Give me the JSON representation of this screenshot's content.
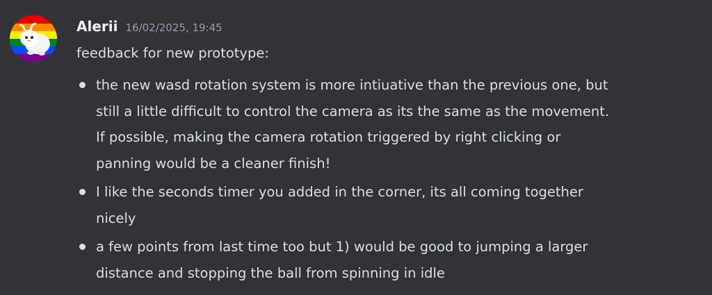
{
  "message": {
    "username": "Alerii",
    "timestamp": "16/02/2025, 19:45",
    "avatar_icon": "white-creature-on-rainbow-flag-avatar",
    "intro": "feedback for new prototype:",
    "bullets": [
      {
        "lines": [
          "the new wasd rotation system is more intiuative than the previous one, but",
          "still a little difficult to control the camera as its the same as the movement.",
          "If possible, making the camera rotation triggered by right clicking or",
          "panning would be a cleaner finish!"
        ]
      },
      {
        "lines": [
          "I like the seconds timer you added in the corner, its all coming together",
          "nicely"
        ]
      },
      {
        "lines": [
          "a few points from last time too but 1) would be good to jumping a larger",
          "distance and stopping the ball from spinning in idle"
        ]
      }
    ]
  },
  "colors": {
    "background": "#323339",
    "username": "#f2f3f5",
    "text": "#dbdee1",
    "timestamp": "#9a9ba3"
  }
}
